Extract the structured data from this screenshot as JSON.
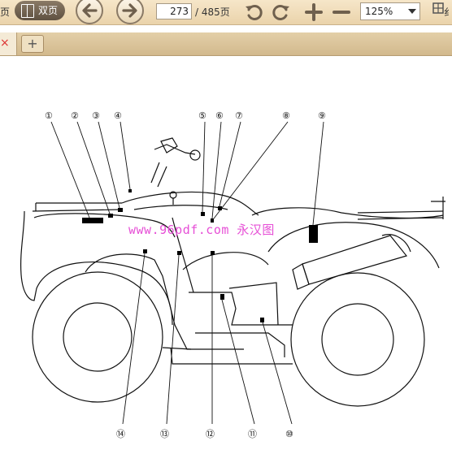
{
  "toolbar": {
    "left_cut_label": "页",
    "dual_page_label": "双页",
    "current_page": "273",
    "total_pages": "/ 485页",
    "zoom_value": "125%",
    "right_cut_label": "纟"
  },
  "tabs": {
    "close_glyph": "×",
    "new_tab_glyph": "+"
  },
  "diagram": {
    "callouts": [
      "①",
      "②",
      "③",
      "④",
      "⑤",
      "⑥",
      "⑦",
      "⑧",
      "⑨",
      "⑩",
      "⑪",
      "⑫",
      "⑬",
      "⑭"
    ],
    "watermark": "www.96pdf.com 永汉图"
  },
  "colors": {
    "toolbar_bg": "#eedcbc",
    "watermark": "#e64fd6",
    "close_x": "#dd3333"
  }
}
